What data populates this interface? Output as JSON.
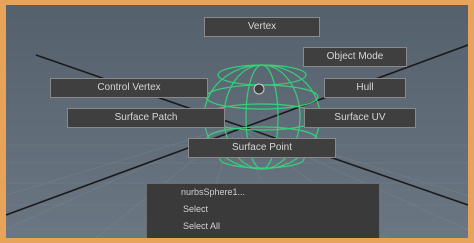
{
  "marking_menu": {
    "north": "Vertex",
    "northeast": "Object Mode",
    "west": "Control Vertex",
    "east": "Hull",
    "southwest": "Surface Patch",
    "southeast": "Surface UV",
    "south": "Surface Point"
  },
  "context_menu": {
    "header": "nurbsSphere1...",
    "items": [
      "Select",
      "Select All"
    ]
  },
  "colors": {
    "frame_border": "#e8a35a",
    "viewport_top": "#55606d",
    "viewport_bottom": "#6b7683",
    "wireframe": "#35d07a",
    "menu_bg": "#3f3f3f",
    "menu_border": "#8a8a8a",
    "menu_text": "#d6d6d6"
  }
}
